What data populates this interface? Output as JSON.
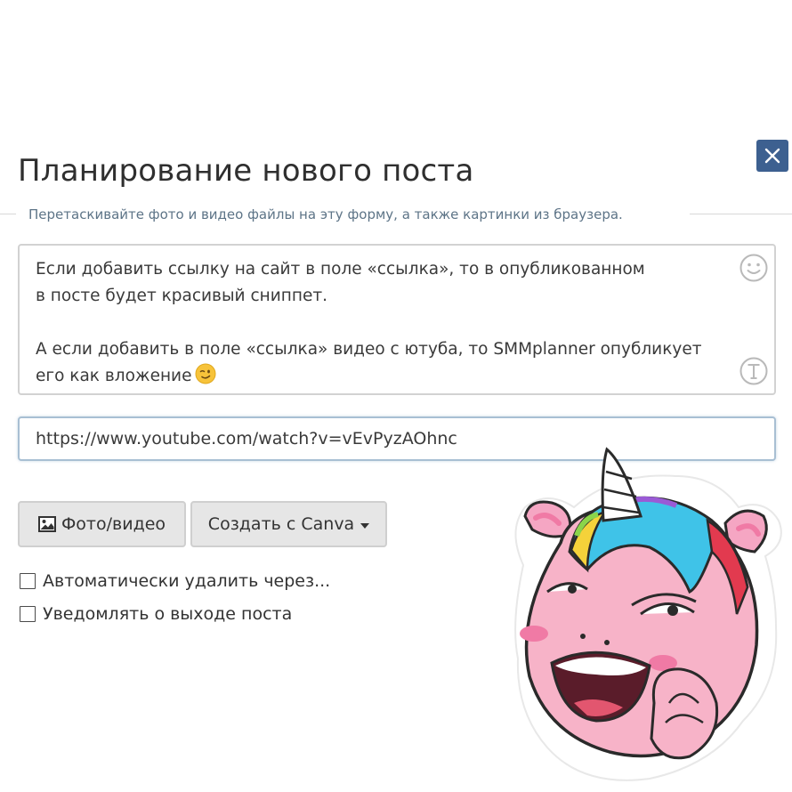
{
  "dialog": {
    "title": "Планирование нового поста",
    "hint": "Перетаскивайте фото и видео файлы на эту форму, а также картинки из браузера."
  },
  "post_text": {
    "line1": "Если добавить ссылку на сайт в поле «ссылка», то в опубликованном",
    "line2": "в посте будет красивый сниппет.",
    "line3": "А если добавить в поле «ссылка» видео с ютуба, то SMMplanner опубликует",
    "line4": "его как вложение"
  },
  "link_field": {
    "value": "https://www.youtube.com/watch?v=vEvPyzAOhnc"
  },
  "buttons": {
    "photo_video": "Фото/видео",
    "canva": "Создать с Canva"
  },
  "options": {
    "auto_delete": "Автоматически удалить через...",
    "notify": "Уведомлять о выходе поста"
  },
  "icons": {
    "close": "close-icon",
    "emoji": "smile-icon",
    "text_format": "text-format-icon",
    "image": "image-icon",
    "wink": "wink-emoji-icon",
    "sticker": "unicorn-sticker"
  },
  "colors": {
    "close_bg": "#3d6090",
    "hint_text": "#5d7487",
    "button_bg": "#e6e6e6"
  }
}
